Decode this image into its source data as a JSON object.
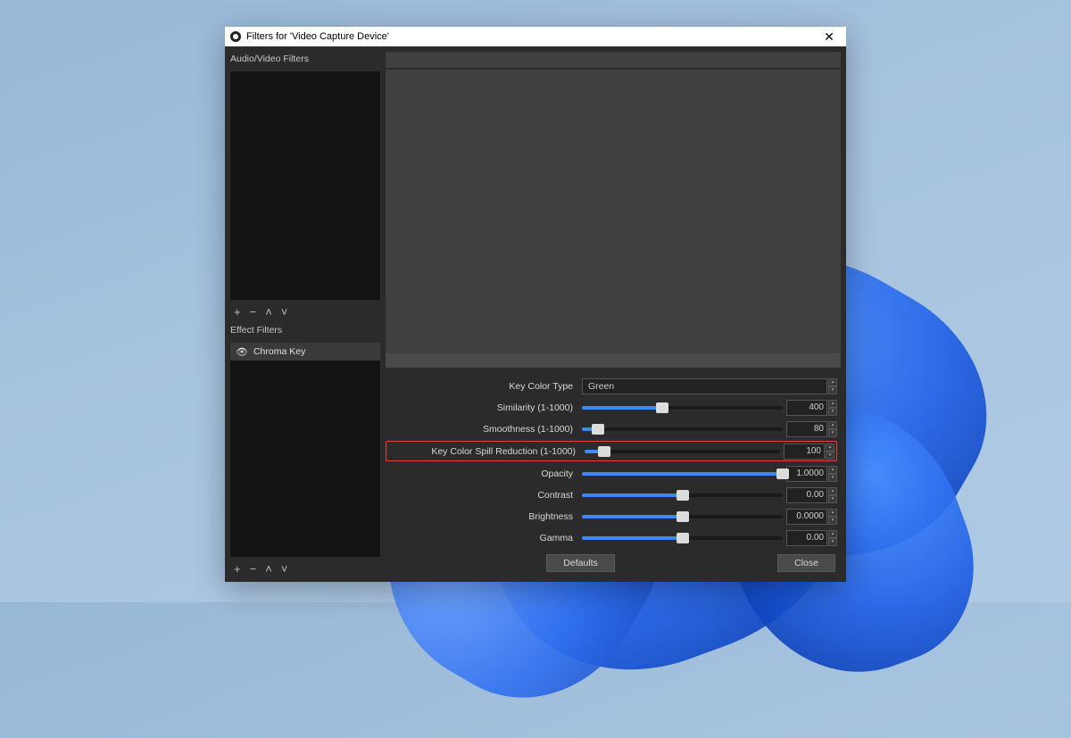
{
  "window": {
    "title": "Filters for 'Video Capture Device'"
  },
  "left": {
    "audio_header": "Audio/Video Filters",
    "effect_header": "Effect Filters",
    "effect_items": [
      {
        "label": "Chroma Key"
      }
    ]
  },
  "toolbar_icons": {
    "add": "+",
    "remove": "−",
    "up": "˄",
    "down": "˅"
  },
  "props": {
    "key_color_type": {
      "label": "Key Color Type",
      "value": "Green"
    },
    "similarity": {
      "label": "Similarity (1-1000)",
      "value": "400",
      "fill": 40,
      "thumb": 40
    },
    "smoothness": {
      "label": "Smoothness (1-1000)",
      "value": "80",
      "fill": 8,
      "thumb": 8
    },
    "spill": {
      "label": "Key Color Spill Reduction (1-1000)",
      "value": "100",
      "fill": 10,
      "thumb": 10
    },
    "opacity": {
      "label": "Opacity",
      "value": "1.0000",
      "fill": 100,
      "thumb": 100
    },
    "contrast": {
      "label": "Contrast",
      "value": "0.00",
      "fill": 50,
      "thumb": 50
    },
    "brightness": {
      "label": "Brightness",
      "value": "0.0000",
      "fill": 50,
      "thumb": 50
    },
    "gamma": {
      "label": "Gamma",
      "value": "0.00",
      "fill": 50,
      "thumb": 50
    }
  },
  "buttons": {
    "defaults": "Defaults",
    "close": "Close"
  }
}
